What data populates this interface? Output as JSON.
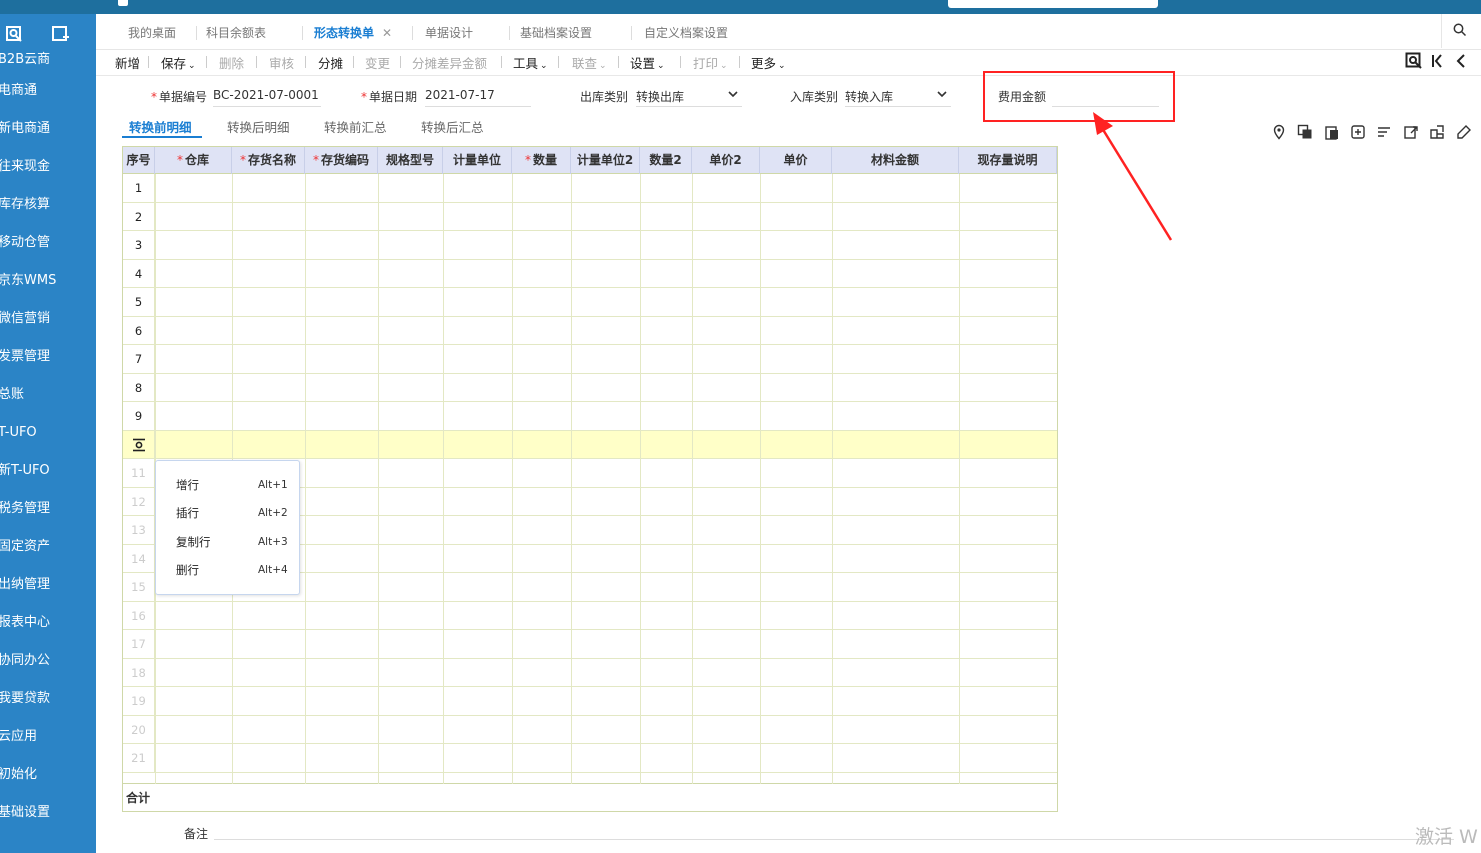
{
  "sidebar": {
    "items": [
      "B2B云商",
      "电商通",
      "新电商通",
      "往来现金",
      "库存核算",
      "移动仓管",
      "京东WMS",
      "微信营销",
      "发票管理",
      "总账",
      "T-UFO",
      "新T-UFO",
      "税务管理",
      "固定资产",
      "出纳管理",
      "报表中心",
      "协同办公",
      "我要贷款",
      "云应用",
      "初始化",
      "基础设置"
    ]
  },
  "tabs": [
    {
      "label": "我的桌面"
    },
    {
      "label": "科目余额表"
    },
    {
      "label": "形态转换单",
      "close": "✕"
    },
    {
      "label": "单据设计"
    },
    {
      "label": "基础档案设置"
    },
    {
      "label": "自定义档案设置"
    }
  ],
  "toolbar": {
    "new": "新增",
    "save": "保存",
    "delete": "删除",
    "audit": "审核",
    "allocate": "分摊",
    "change": "变更",
    "allocate_diff": "分摊差异金额",
    "tools": "工具",
    "query": "联查",
    "settings": "设置",
    "print": "打印",
    "more": "更多"
  },
  "header": {
    "doc_no_label": "单据编号",
    "doc_no": "BC-2021-07-0001",
    "doc_date_label": "单据日期",
    "doc_date": "2021-07-17",
    "out_type_label": "出库类别",
    "out_type": "转换出库",
    "in_type_label": "入库类别",
    "in_type": "转换入库",
    "fee_label": "费用金额",
    "fee_value": ""
  },
  "detail_tabs": [
    "转换前明细",
    "转换后明细",
    "转换前汇总",
    "转换后汇总"
  ],
  "grid": {
    "columns": [
      {
        "label": "序号",
        "required": false
      },
      {
        "label": "仓库",
        "required": true
      },
      {
        "label": "存货名称",
        "required": true
      },
      {
        "label": "存货编码",
        "required": true
      },
      {
        "label": "规格型号",
        "required": false
      },
      {
        "label": "计量单位",
        "required": false
      },
      {
        "label": "数量",
        "required": true
      },
      {
        "label": "计量单位2",
        "required": false
      },
      {
        "label": "数量2",
        "required": false
      },
      {
        "label": "单价2",
        "required": false
      },
      {
        "label": "单价",
        "required": false
      },
      {
        "label": "材料金额",
        "required": false
      },
      {
        "label": "现存量说明",
        "required": false
      }
    ],
    "rows": [
      "1",
      "2",
      "3",
      "4",
      "5",
      "6",
      "7",
      "8",
      "9",
      "",
      "11",
      "12",
      "13",
      "14",
      "15",
      "16",
      "17",
      "18",
      "19",
      "20",
      "21"
    ],
    "total_label": "合计"
  },
  "context_menu": [
    {
      "label": "增行",
      "key": "Alt+1"
    },
    {
      "label": "插行",
      "key": "Alt+2"
    },
    {
      "label": "复制行",
      "key": "Alt+3"
    },
    {
      "label": "删行",
      "key": "Alt+4"
    }
  ],
  "remarks_label": "备注",
  "watermark": "激活 W",
  "colors": {
    "sidebar": "#2b84c6",
    "accent": "#1a7ed2",
    "grid_header": "#dfe3f5",
    "highlight_row": "#ffffc8",
    "annotation": "#ff2222"
  }
}
